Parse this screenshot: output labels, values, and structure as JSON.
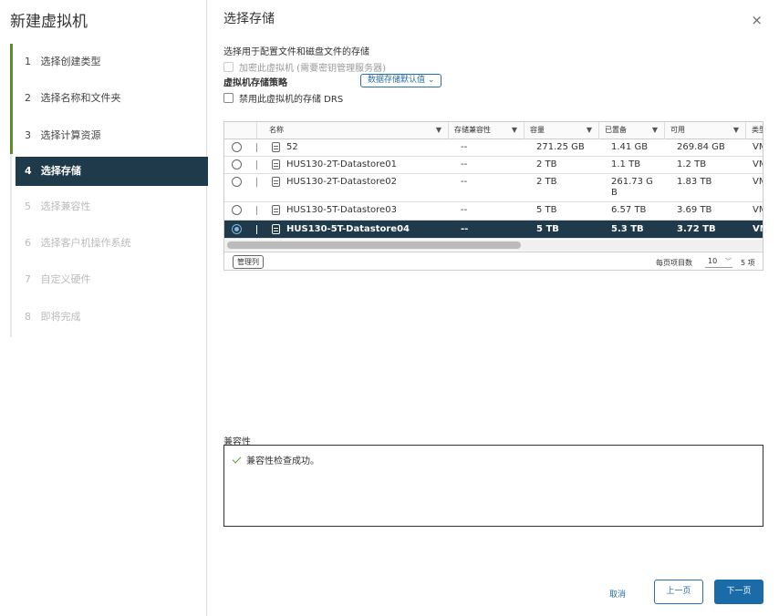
{
  "wizard": {
    "title": "新建虚拟机",
    "steps": [
      {
        "num": "1",
        "label": "选择创建类型"
      },
      {
        "num": "2",
        "label": "选择名称和文件夹"
      },
      {
        "num": "3",
        "label": "选择计算资源"
      },
      {
        "num": "4",
        "label": "选择存储"
      },
      {
        "num": "5",
        "label": "选择兼容性"
      },
      {
        "num": "6",
        "label": "选择客户机操作系统"
      },
      {
        "num": "7",
        "label": "自定义硬件"
      },
      {
        "num": "8",
        "label": "即将完成"
      }
    ]
  },
  "page": {
    "title": "选择存储",
    "close": "×",
    "subheading": "选择用于配置文件和磁盘文件的存储",
    "encrypt_label": "加密此虚拟机 (需要密钥管理服务器)",
    "policy_label": "虚拟机存储策略",
    "policy_value": "数据存储默认值 ⌄",
    "disable_drs_label": "禁用此虚拟机的存储 DRS"
  },
  "grid": {
    "columns": [
      "名称",
      "存储兼容性",
      "容量",
      "已置备",
      "可用",
      "类型"
    ],
    "rows": [
      {
        "name": "52",
        "compat": "--",
        "capacity": "271.25 GB",
        "provisioned": "1.41 GB",
        "free": "269.84 GB",
        "type": "VM"
      },
      {
        "name": "HUS130-2T-Datastore01",
        "compat": "--",
        "capacity": "2 TB",
        "provisioned": "1.1 TB",
        "free": "1.2 TB",
        "type": "VM"
      },
      {
        "name": "HUS130-2T-Datastore02",
        "compat": "--",
        "capacity": "2 TB",
        "provisioned": "261.73 G",
        "provisioned2": "B",
        "free": "1.83 TB",
        "type": "VM"
      },
      {
        "name": "HUS130-5T-Datastore03",
        "compat": "--",
        "capacity": "5 TB",
        "provisioned": "6.57 TB",
        "free": "3.69 TB",
        "type": "VM"
      },
      {
        "name": "HUS130-5T-Datastore04",
        "compat": "--",
        "capacity": "5 TB",
        "provisioned": "5.3 TB",
        "free": "3.72 TB",
        "type": "VM"
      }
    ],
    "manage_columns": "管理列",
    "per_page_label": "每页项目数",
    "per_page_value": "10",
    "total": "5 项"
  },
  "compatibility": {
    "label": "兼容性",
    "message": "兼容性检查成功。"
  },
  "footer": {
    "cancel": "取消",
    "back": "上一页",
    "next": "下一页"
  }
}
